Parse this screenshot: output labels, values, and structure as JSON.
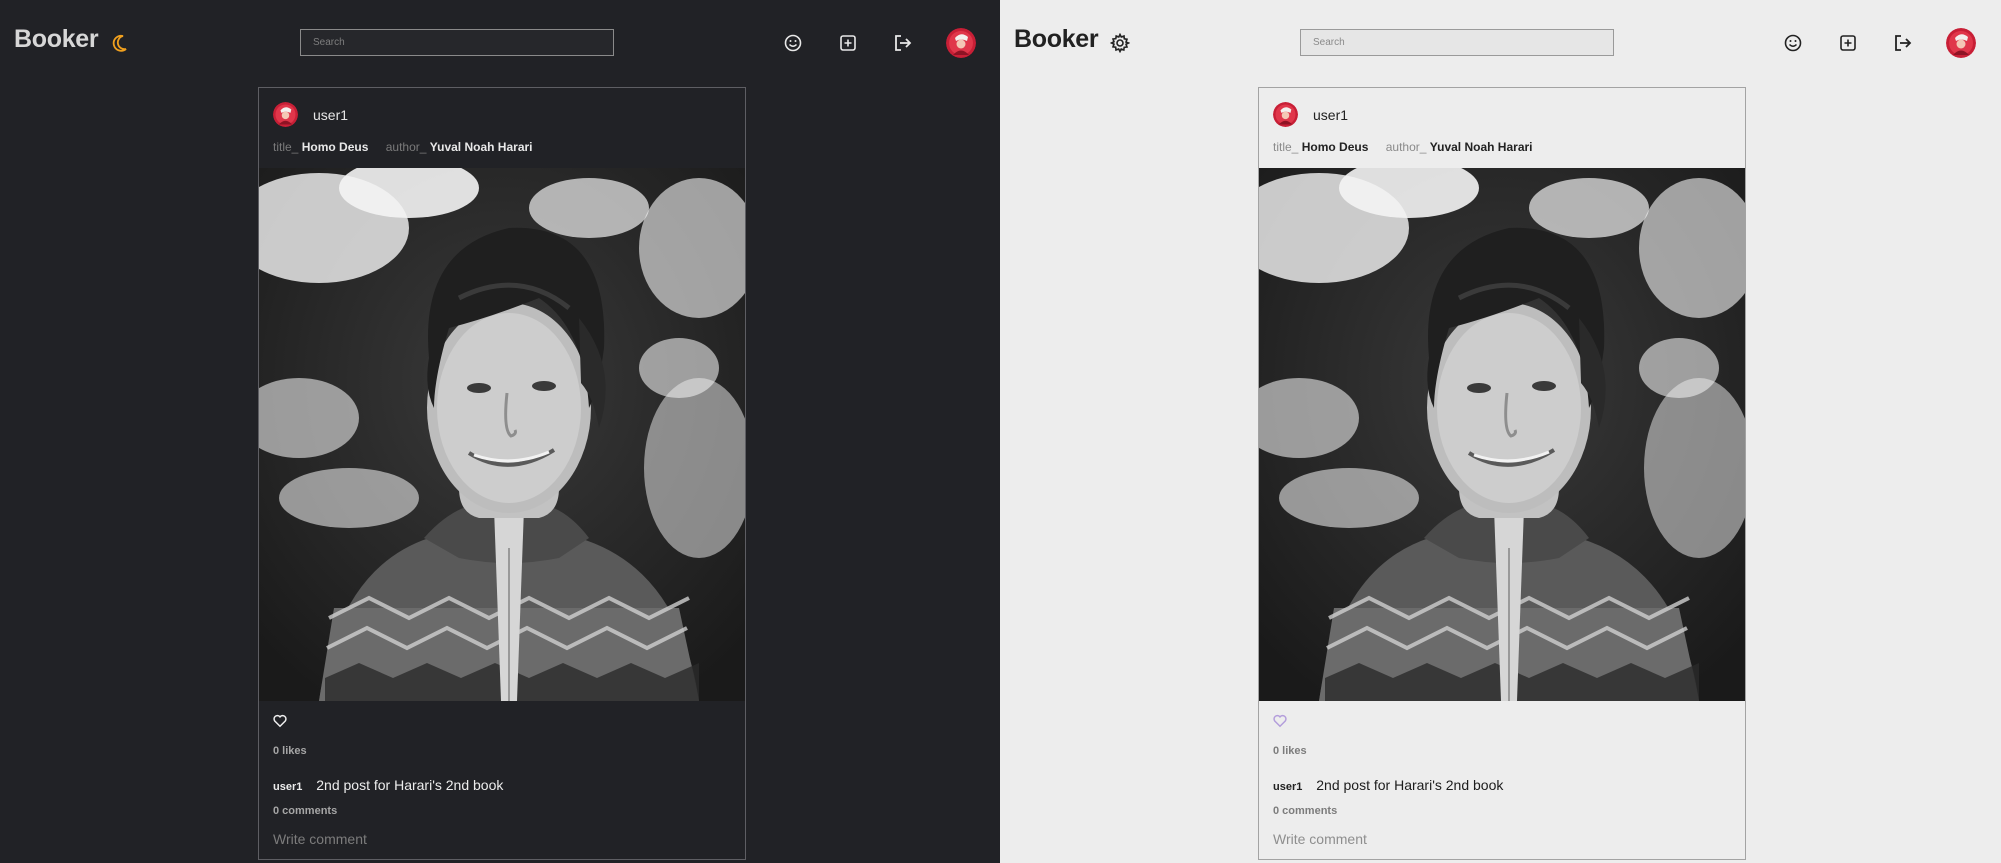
{
  "dark_pane": {
    "brand": "Booker",
    "theme_icon": "moon-icon",
    "search": {
      "placeholder": "Search",
      "value": ""
    },
    "nav_icons": [
      "smiley-icon",
      "plus-square-icon",
      "logout-icon"
    ],
    "post": {
      "username": "user1",
      "title_label": "title_",
      "title_value": "Homo Deus",
      "author_label": "author_",
      "author_value": "Yuval Noah Harari",
      "likes": "0 likes",
      "caption_user": "user1",
      "caption_text": "2nd post for Harari's 2nd book",
      "comments": "0 comments",
      "comment_placeholder": "Write comment"
    }
  },
  "light_pane": {
    "brand": "Booker",
    "theme_icon": "gear-icon",
    "search": {
      "placeholder": "Search",
      "value": ""
    },
    "nav_icons": [
      "smiley-icon",
      "plus-square-icon",
      "logout-icon"
    ],
    "post": {
      "username": "user1",
      "title_label": "title_",
      "title_value": "Homo Deus",
      "author_label": "author_",
      "author_value": "Yuval Noah Harari",
      "likes": "0 likes",
      "caption_user": "user1",
      "caption_text": "2nd post for Harari's 2nd book",
      "comments": "0 comments",
      "comment_placeholder": "Write comment"
    }
  },
  "colors": {
    "dark_bg": "#212226",
    "light_bg": "#ededed",
    "moon_accent": "#f0a01e",
    "avatar_red": "#d3263a",
    "like_light": "#b39ddb"
  }
}
